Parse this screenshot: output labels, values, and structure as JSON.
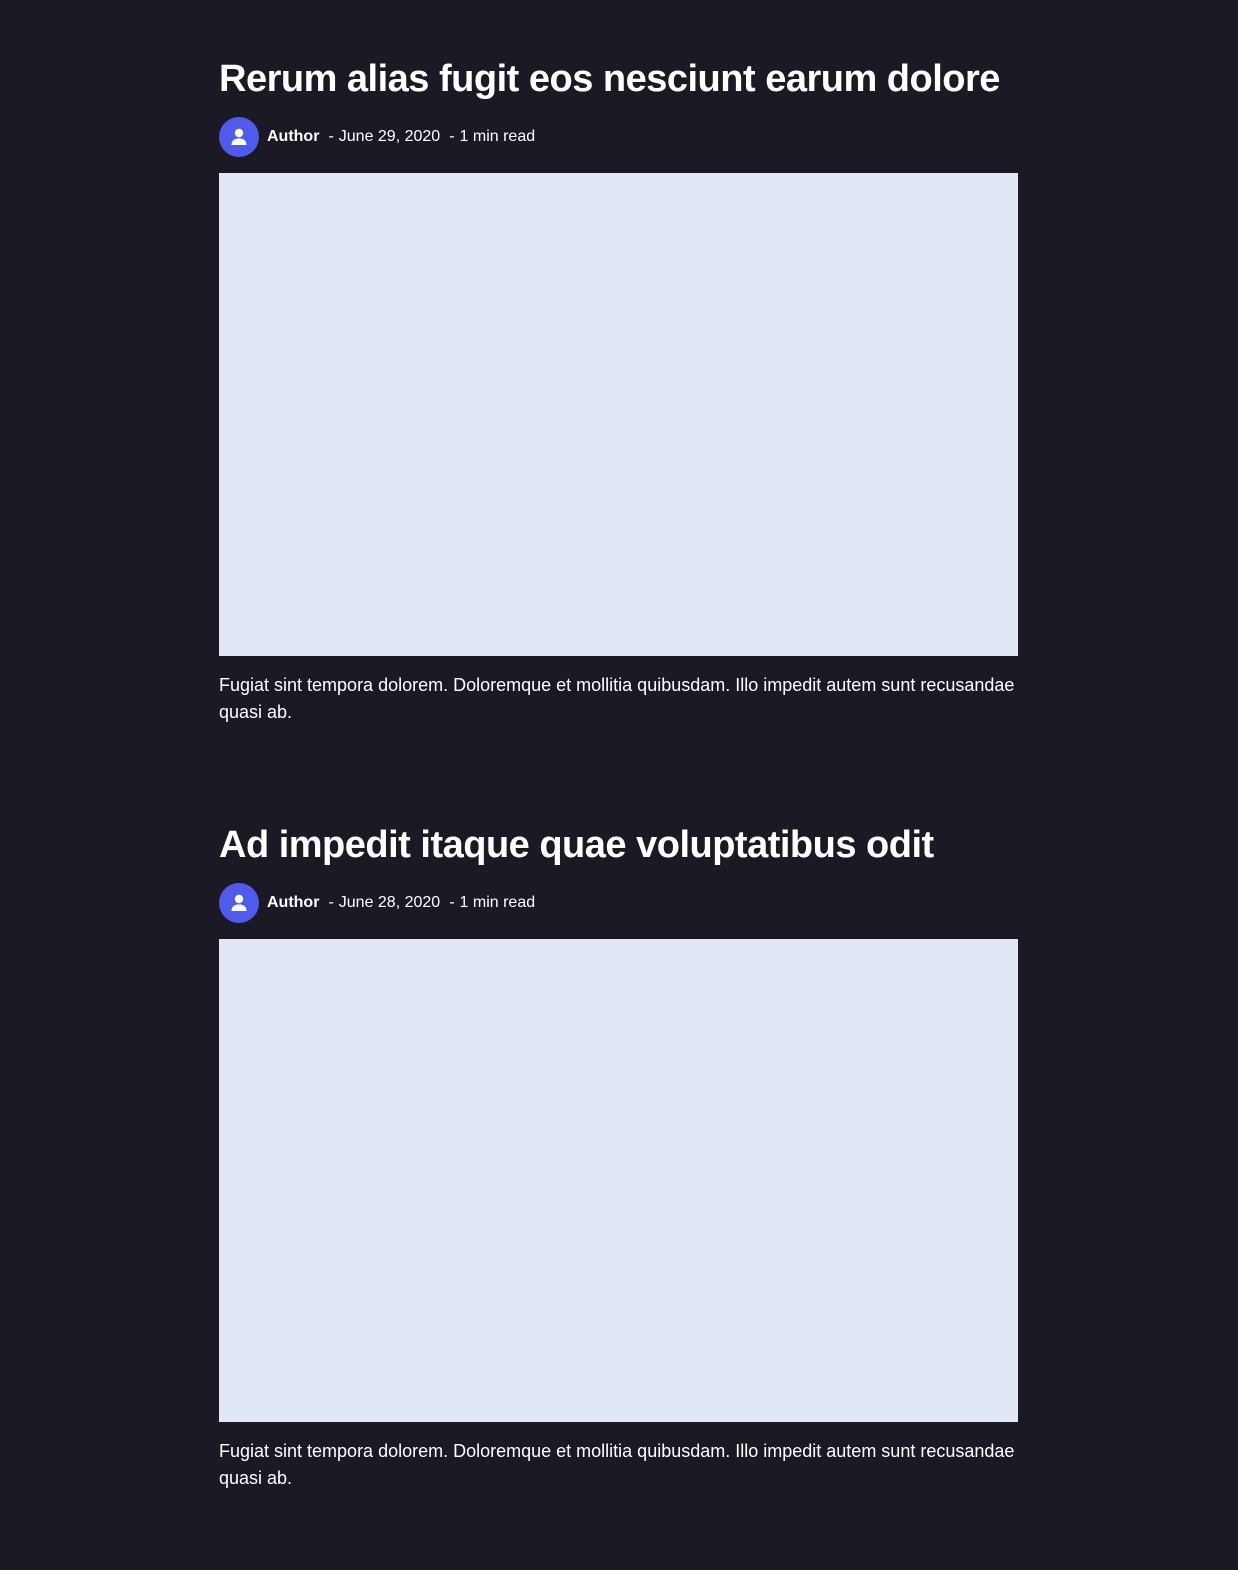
{
  "posts": [
    {
      "title": "Rerum alias fugit eos nesciunt earum dolore",
      "author": "Author",
      "separator": "-",
      "date": "June 29, 2020",
      "read_time": "1 min read",
      "excerpt": "Fugiat sint tempora dolorem. Doloremque et mollitia quibusdam. Illo impedit autem sunt recusandae quasi ab."
    },
    {
      "title": "Ad impedit itaque quae voluptatibus odit",
      "author": "Author",
      "separator": "-",
      "date": "June 28, 2020",
      "read_time": "1 min read",
      "excerpt": "Fugiat sint tempora dolorem. Doloremque et mollitia quibusdam. Illo impedit autem sunt recusandae quasi ab."
    }
  ],
  "icons": {
    "avatar": "user-icon"
  },
  "colors": {
    "background": "#1b1a24",
    "avatar": "#4f5bea",
    "image_placeholder": "#e1e7f4",
    "text": "#ffffff"
  }
}
